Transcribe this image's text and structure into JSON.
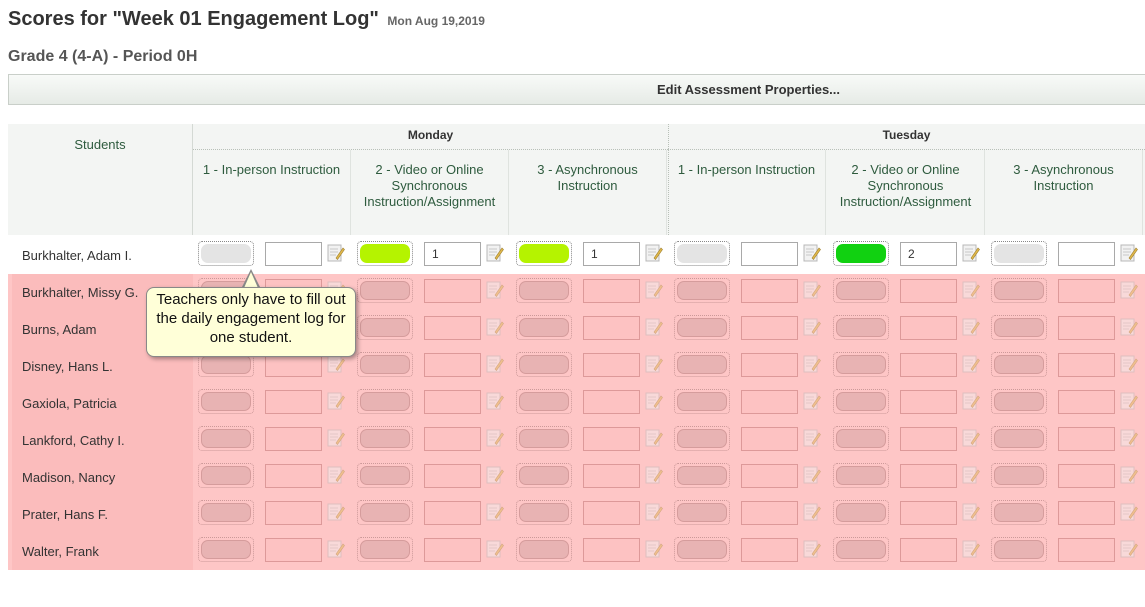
{
  "page": {
    "title": "Scores for \"Week 01 Engagement Log\"",
    "date": "Mon Aug 19,2019",
    "subtitle": "Grade 4 (4-A) - Period 0H",
    "edit_button": "Edit Assessment Properties..."
  },
  "table": {
    "students_header": "Students",
    "days": [
      {
        "label": "Monday",
        "categories": [
          "1 - In-person Instruction",
          "2 - Video or Online Synchronous Instruction/Assignment",
          "3 - Asynchronous Instruction"
        ]
      },
      {
        "label": "Tuesday",
        "categories": [
          "1 - In-person Instruction",
          "2 - Video or Online Synchronous Instruction/Assignment",
          "3 - Asynchronous Instruction"
        ]
      }
    ],
    "students": [
      {
        "name": "Burkhalter, Adam I.",
        "cells": [
          {
            "status": "none",
            "score": ""
          },
          {
            "status": "light-green",
            "score": "1"
          },
          {
            "status": "light-green",
            "score": "1"
          },
          {
            "status": "none",
            "score": ""
          },
          {
            "status": "green",
            "score": "2"
          },
          {
            "status": "none",
            "score": ""
          }
        ]
      },
      {
        "name": "Burkhalter, Missy G."
      },
      {
        "name": "Burns, Adam"
      },
      {
        "name": "Disney, Hans L."
      },
      {
        "name": "Gaxiola, Patricia"
      },
      {
        "name": "Lankford, Cathy I."
      },
      {
        "name": "Madison, Nancy"
      },
      {
        "name": "Prater, Hans F."
      },
      {
        "name": "Walter, Frank"
      }
    ]
  },
  "tooltip": {
    "text": "Teachers only have to fill out the daily engagement log for one student."
  },
  "colors": {
    "light_green": "#b5f300",
    "green": "#11d111",
    "pink_row": "#fec6c6",
    "header_bg": "#f3f5f3",
    "tooltip_bg": "#ffffd8"
  },
  "icons": {
    "note": "note-edit-icon"
  }
}
